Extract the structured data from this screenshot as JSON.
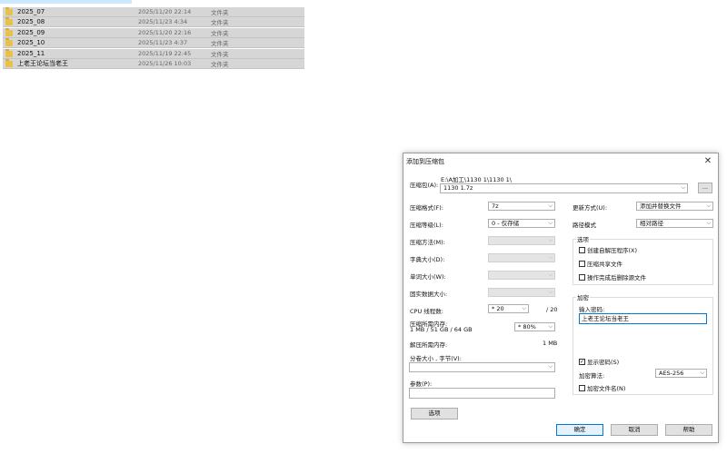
{
  "explorer": {
    "rows": [
      {
        "name": "2025_07",
        "date": "2025/11/20 22:14",
        "type": "文件夹"
      },
      {
        "name": "2025_08",
        "date": "2025/11/23 4:34",
        "type": "文件夹"
      },
      {
        "name": "2025_09",
        "date": "2025/11/20 22:16",
        "type": "文件夹"
      },
      {
        "name": "2025_10",
        "date": "2025/11/23 4:37",
        "type": "文件夹"
      },
      {
        "name": "2025_11",
        "date": "2025/11/19 22:45",
        "type": "文件夹"
      },
      {
        "name": "上老王论坛当老王",
        "date": "2025/11/26 10:03",
        "type": "文件夹"
      }
    ]
  },
  "dialog": {
    "title": "添加到压缩包",
    "close_glyph": "✕",
    "archive": {
      "label": "压缩包(A):",
      "path": "E:\\A加工\\1130 1\\1130 1\\",
      "filename": "1130 1.7z",
      "browse_label": "..."
    },
    "left": {
      "format": {
        "label": "压缩格式(F):",
        "value": "7z"
      },
      "level": {
        "label": "压缩等级(L):",
        "value": "0 - 仅存储"
      },
      "method": {
        "label": "压缩方法(M):",
        "value": ""
      },
      "dict": {
        "label": "字典大小(D):",
        "value": ""
      },
      "word": {
        "label": "单词大小(W):",
        "value": ""
      },
      "solid": {
        "label": "固实数据大小:",
        "value": ""
      },
      "cpu": {
        "label": "CPU 线程数:",
        "value": "* 20",
        "max": "/ 20"
      },
      "mem_comp": {
        "label": "压缩所需内存:",
        "detail": "1 MB / 51 GB / 64 GB",
        "value": "* 80%"
      },
      "mem_decomp": {
        "label": "解压所需内存:",
        "value": "1 MB"
      },
      "split": {
        "label": "分卷大小 , 字节(V):",
        "value": ""
      },
      "params": {
        "label": "参数(P):",
        "value": ""
      },
      "options_button": "选项"
    },
    "right": {
      "update": {
        "label": "更新方式(U):",
        "value": "添加并替换文件"
      },
      "pathmode": {
        "label": "路径模式",
        "value": "相对路径"
      },
      "options_group": {
        "title": "选项",
        "sfx": {
          "label": "创建自解压程序(X)",
          "checked": false
        },
        "shared": {
          "label": "压缩共享文件",
          "checked": false
        },
        "delete": {
          "label": "操作完成后删除源文件",
          "checked": false
        }
      },
      "encryption": {
        "title": "加密",
        "password_label": "输入密码:",
        "password_value": "上老王论坛当老王",
        "show_password": {
          "label": "显示密码(S)",
          "checked": true
        },
        "method_label": "加密算法:",
        "method_value": "AES-256",
        "encrypt_names": {
          "label": "加密文件名(N)",
          "checked": false
        }
      }
    },
    "buttons": {
      "ok": "确定",
      "cancel": "取消",
      "help": "帮助"
    }
  }
}
